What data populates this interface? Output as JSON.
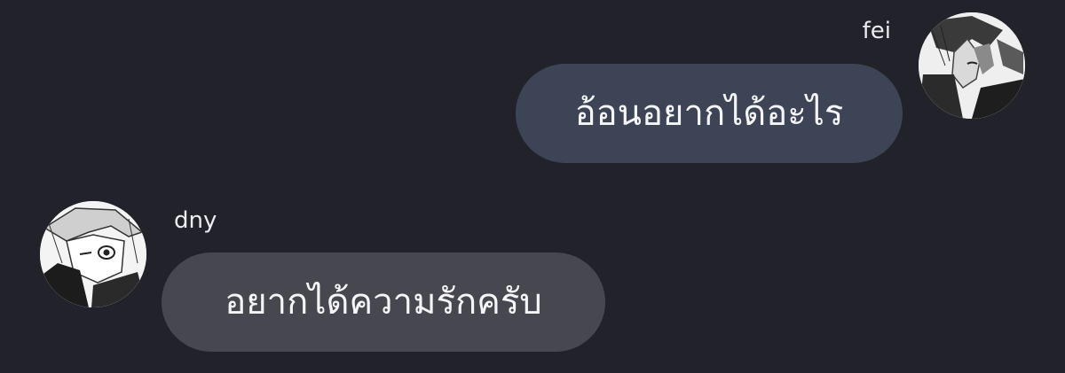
{
  "colors": {
    "background": "#22232a",
    "outgoing_bubble": "#3d4455",
    "incoming_bubble": "#47484f",
    "text": "#f5f5f7"
  },
  "messages": [
    {
      "direction": "outgoing",
      "sender": "fei",
      "text": "อ้อนอยากได้อะไร",
      "avatar_icon": "manga-character-avatar-icon"
    },
    {
      "direction": "incoming",
      "sender": "dny",
      "text": "อยากได้ความรักครับ",
      "avatar_icon": "manga-character-avatar-icon"
    }
  ]
}
